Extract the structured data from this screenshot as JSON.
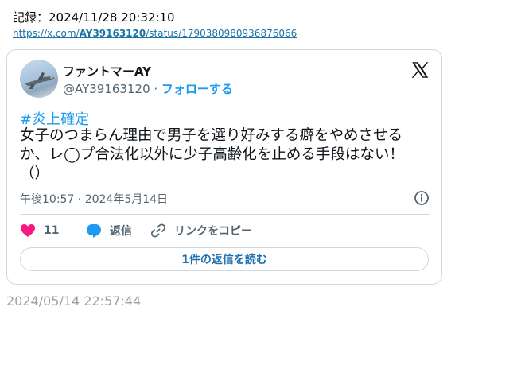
{
  "record": "記録：2024/11/28 20:32:10",
  "url": {
    "prefix": "https://x.com/",
    "user": "AY39163120",
    "suffix": "/status/1790380980936876066"
  },
  "tweet": {
    "display_name": "ファントマーAY",
    "handle": "@AY39163120",
    "separator": " · ",
    "follow_label": "フォローする",
    "hashtag": "#炎上確定",
    "text": "女子のつまらん理由で男子を選り好みする癖をやめさせるか、レ◯プ合法化以外に少子高齢化を止める手段はない！（）",
    "timestamp": "午後10:57 · 2024年5月14日",
    "like_count": "11",
    "reply_label": "返信",
    "copy_link_label": "リンクをコピー",
    "read_replies_label": "1件の返信を読む"
  },
  "footer_date": "2024/05/14 22:57:44",
  "colors": {
    "accent": "#1d9bf0",
    "like": "#f91880",
    "muted": "#536471",
    "border": "#cfd9de"
  },
  "icons": {
    "logo": "x-logo-icon",
    "like": "heart-icon",
    "reply": "speech-bubble-icon",
    "copy": "link-icon",
    "info": "info-icon"
  }
}
